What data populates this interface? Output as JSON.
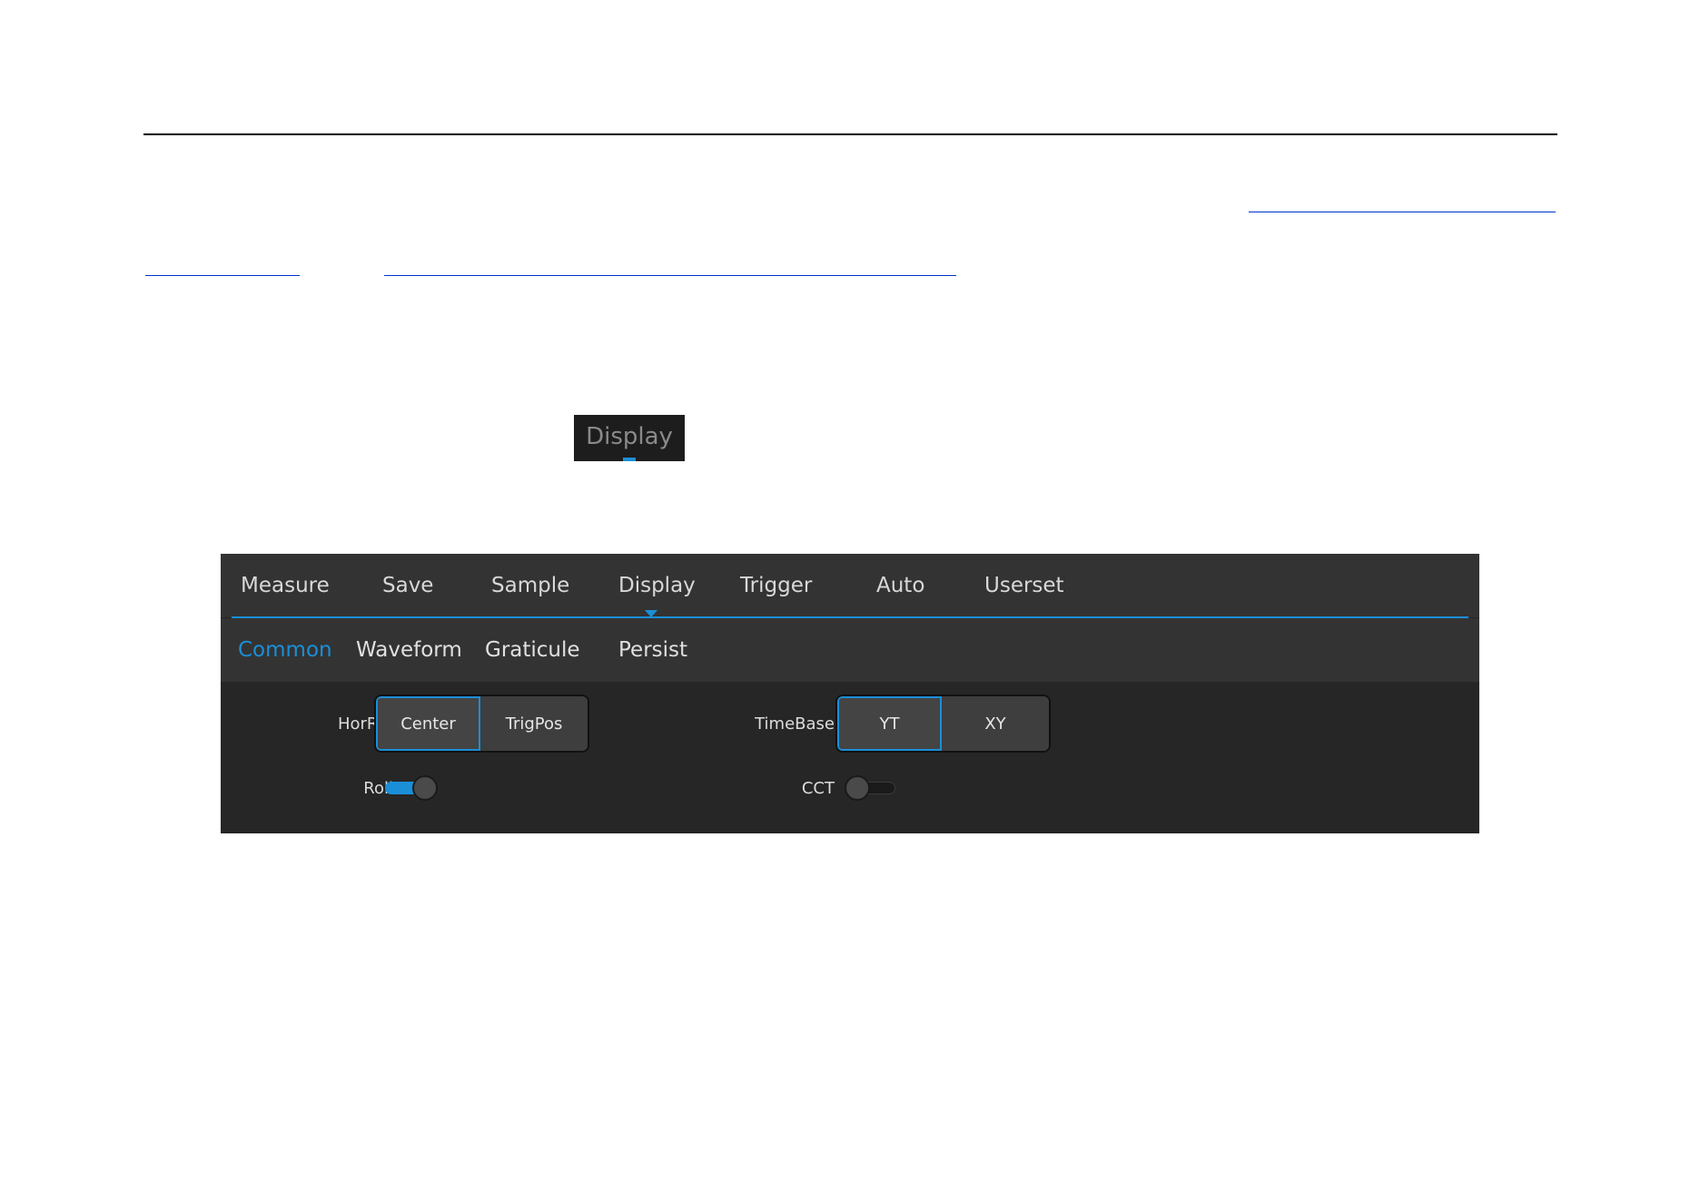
{
  "display_chip": {
    "label": "Display"
  },
  "menu": {
    "tabs": [
      {
        "label": "Measure"
      },
      {
        "label": "Save"
      },
      {
        "label": "Sample"
      },
      {
        "label": "Display"
      },
      {
        "label": "Trigger"
      },
      {
        "label": "Auto"
      },
      {
        "label": "Userset"
      }
    ],
    "active_tab": "Display"
  },
  "submenu": {
    "tabs": [
      {
        "label": "Common"
      },
      {
        "label": "Waveform"
      },
      {
        "label": "Graticule"
      },
      {
        "label": "Persist"
      }
    ],
    "active_tab": "Common"
  },
  "settings": {
    "horref": {
      "label": "HorRef",
      "options": [
        {
          "label": "Center"
        },
        {
          "label": "TrigPos"
        }
      ],
      "selected": "Center"
    },
    "timebase": {
      "label": "TimeBase",
      "options": [
        {
          "label": "YT"
        },
        {
          "label": "XY"
        }
      ],
      "selected": "YT"
    },
    "roll": {
      "label": "Roll",
      "on": true
    },
    "cct": {
      "label": "CCT",
      "on": false
    }
  },
  "colors": {
    "accent": "#1a8fd8",
    "panel_bg": "#262626",
    "bar_bg": "#333333"
  }
}
